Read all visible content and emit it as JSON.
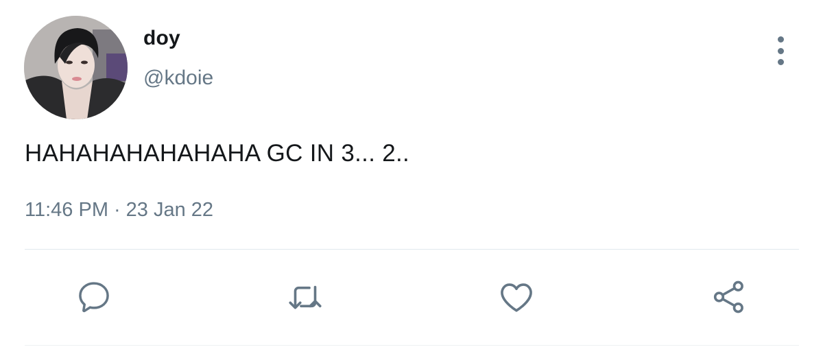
{
  "tweet": {
    "display_name": "doy",
    "handle": "@kdoie",
    "text": "HAHAHAHAHAHAHA GC IN 3... 2..",
    "time": "11:46 PM",
    "separator": "·",
    "date": "23 Jan 22"
  },
  "icons": {
    "more": "more-vertical-icon",
    "reply": "reply-bubble-icon",
    "retweet": "retweet-icon",
    "like": "heart-icon",
    "share": "share-icon"
  },
  "colors": {
    "text_primary": "#14171a",
    "text_secondary": "#657786",
    "divider": "#e1e8ed"
  }
}
